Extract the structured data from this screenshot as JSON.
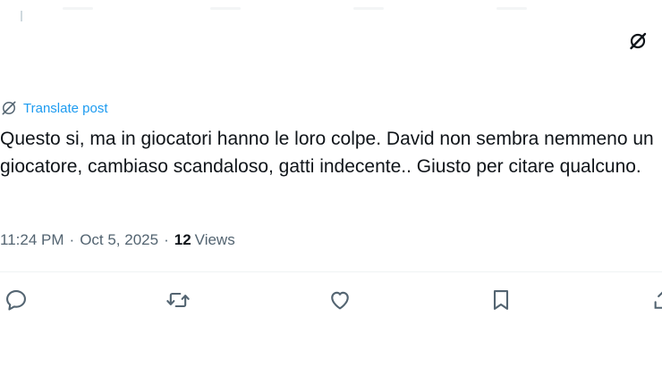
{
  "post": {
    "translate_label": "Translate post",
    "text": "Questo si, ma in giocatori hanno le loro colpe. David non sembra nemmeno un giocatore, cambiaso scandaloso, gatti indecente.. Giusto per citare qualcuno.",
    "time": "11:24 PM",
    "separator": "·",
    "date": "Oct 5, 2025",
    "views_count": "12",
    "views_label": "Views"
  },
  "colors": {
    "link": "#1d9bf0",
    "text": "#0f1419",
    "secondary": "#536471",
    "divider": "#eff3f4"
  },
  "icons": {
    "top_right": "grok-icon",
    "translate": "translate-icon",
    "reply": "reply-icon",
    "repost": "repost-icon",
    "like": "like-icon",
    "bookmark": "bookmark-icon",
    "share": "share-icon"
  }
}
